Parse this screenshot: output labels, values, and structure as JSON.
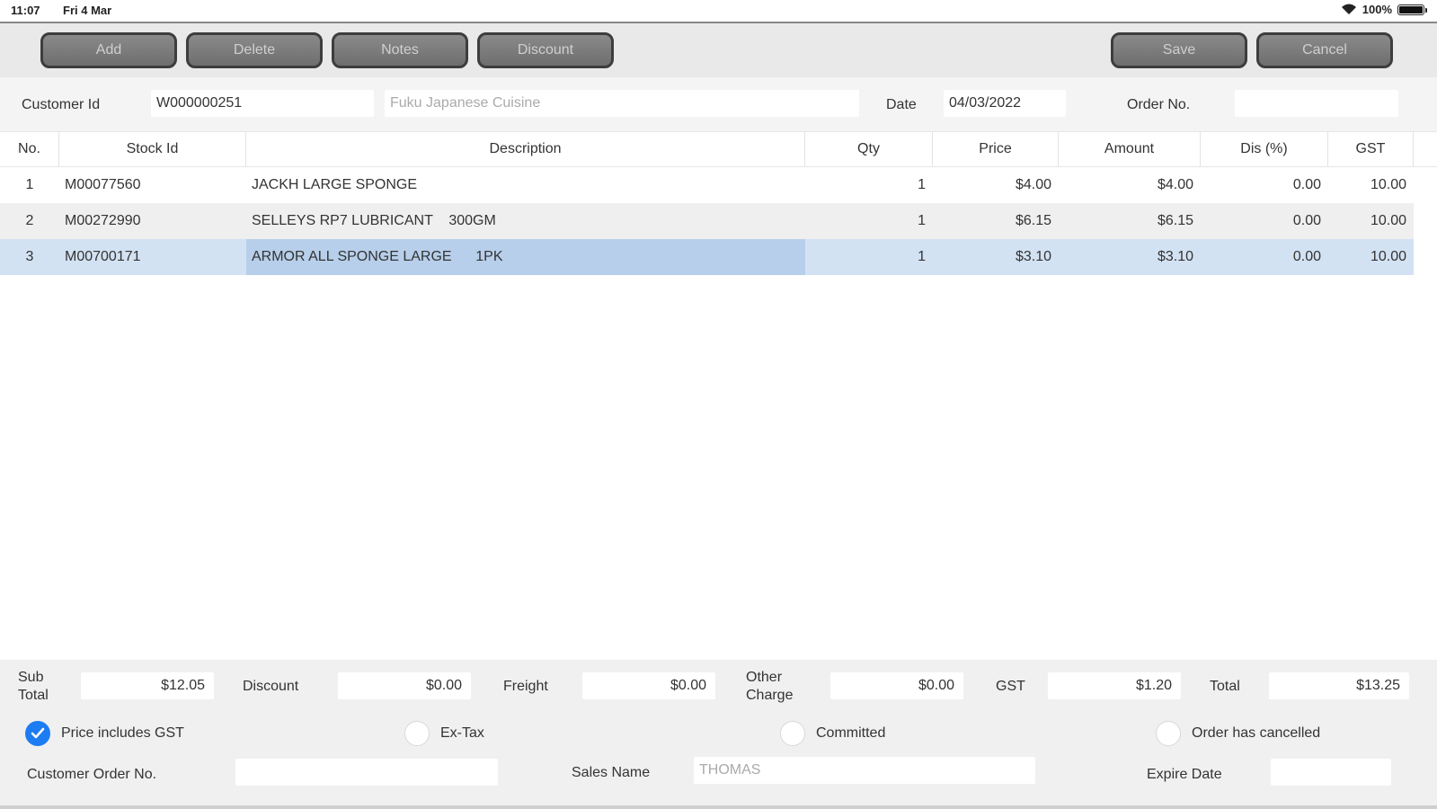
{
  "status_bar": {
    "time": "11:07",
    "date": "Fri 4 Mar",
    "battery": "100%"
  },
  "toolbar": {
    "add_label": "Add",
    "delete_label": "Delete",
    "notes_label": "Notes",
    "discount_label": "Discount",
    "save_label": "Save",
    "cancel_label": "Cancel"
  },
  "header": {
    "customer_id_label": "Customer Id",
    "customer_id_value": "W000000251",
    "customer_name": "Fuku Japanese Cuisine",
    "date_label": "Date",
    "date_value": "04/03/2022",
    "order_no_label": "Order No.",
    "order_no_value": ""
  },
  "table": {
    "columns": [
      "No.",
      "Stock Id",
      "Description",
      "Qty",
      "Price",
      "Amount",
      "Dis (%)",
      "GST"
    ],
    "rows": [
      {
        "no": "1",
        "stock_id": "M00077560",
        "description": "JACKH LARGE SPONGE",
        "qty": "1",
        "price": "$4.00",
        "amount": "$4.00",
        "dis": "0.00",
        "gst": "10.00"
      },
      {
        "no": "2",
        "stock_id": "M00272990",
        "description": "SELLEYS RP7 LUBRICANT    300GM",
        "qty": "1",
        "price": "$6.15",
        "amount": "$6.15",
        "dis": "0.00",
        "gst": "10.00"
      },
      {
        "no": "3",
        "stock_id": "M00700171",
        "description": "ARMOR ALL SPONGE LARGE      1PK",
        "qty": "1",
        "price": "$3.10",
        "amount": "$3.10",
        "dis": "0.00",
        "gst": "10.00"
      }
    ]
  },
  "totals": {
    "sub_total_label_1": "Sub",
    "sub_total_label_2": "Total",
    "sub_total_value": "$12.05",
    "discount_label": "Discount",
    "discount_value": "$0.00",
    "freight_label": "Freight",
    "freight_value": "$0.00",
    "other_charge_label_1": "Other",
    "other_charge_label_2": "Charge",
    "other_charge_value": "$0.00",
    "gst_label": "GST",
    "gst_value": "$1.20",
    "total_label": "Total",
    "total_value": "$13.25"
  },
  "options": {
    "price_includes_gst_label": "Price includes GST",
    "price_includes_gst_checked": true,
    "ex_tax_label": "Ex-Tax",
    "committed_label": "Committed",
    "order_cancelled_label": "Order has cancelled",
    "customer_order_no_label": "Customer Order No.",
    "customer_order_no_value": "",
    "sales_name_label": "Sales Name",
    "sales_name_value": "THOMAS",
    "expire_date_label": "Expire Date",
    "expire_date_value": ""
  },
  "colors": {
    "accent": "#1e7cf2",
    "selected_row": "#d3e2f3",
    "button_bg": "#7a7a7a"
  }
}
